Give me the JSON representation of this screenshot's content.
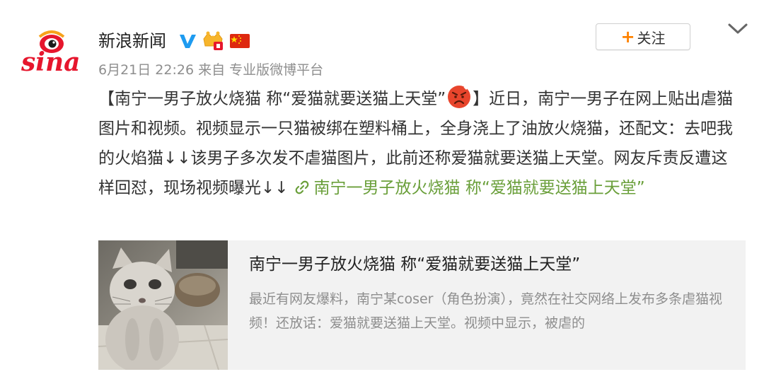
{
  "account": {
    "name": "新浪新闻",
    "avatar_icon": "sina-logo",
    "badges": [
      "verified-v-icon",
      "vip-crown-icon",
      "china-flag-icon"
    ],
    "verified_color": "#1e9bf0"
  },
  "meta": {
    "time": "6月21日 22:26",
    "source_prefix": "来自",
    "source": "专业版微博平台"
  },
  "follow_button": {
    "plus": "+",
    "label": "关注",
    "accent": "#ff8200"
  },
  "menu": {
    "icon": "chevron-down-icon"
  },
  "post": {
    "text_open": "【南宁一男子放火烧猫  称“爱猫就要送猫上天堂”",
    "emoji": "angry-face-icon",
    "text_main": "】近日，南宁一男子在网上贴出虐猫图片和视频。视频显示一只猫被绑在塑料桶上，全身浇上了油放火烧猫，还配文：去吧我的火焰猫↓↓该男子多次发不虐猫图片，此前还称爱猫就要送猫上天堂。网友斥责反遭这样回怼，现场视频曝光↓↓",
    "link_icon": "link-icon",
    "link_text": "南宁一男子放火烧猫 称“爱猫就要送猫上天堂”",
    "link_color": "#6a9f3a"
  },
  "card": {
    "title": "南宁一男子放火烧猫 称“爱猫就要送猫上天堂”",
    "description": "最近有网友爆料，南宁某coser（角色扮演），竟然在社交网络上发布多条虐猫视频！还放话：爱猫就要送猫上天堂。视频中显示，被虐的"
  }
}
